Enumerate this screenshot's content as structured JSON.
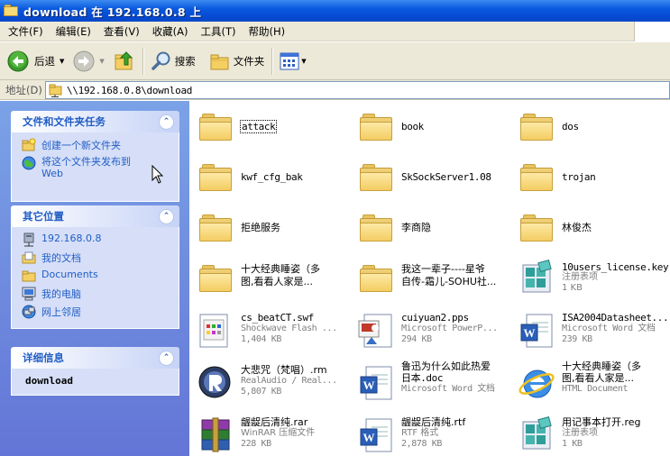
{
  "window": {
    "title": "download 在 192.168.0.8 上"
  },
  "menu": [
    {
      "label": "文件(F)"
    },
    {
      "label": "编辑(E)"
    },
    {
      "label": "查看(V)"
    },
    {
      "label": "收藏(A)"
    },
    {
      "label": "工具(T)"
    },
    {
      "label": "帮助(H)"
    }
  ],
  "toolbar": {
    "back_label": "后退",
    "search_label": "搜索",
    "folders_label": "文件夹"
  },
  "address": {
    "label": "地址(D)",
    "value": "\\\\192.168.0.8\\download"
  },
  "tasks_panel": {
    "title": "文件和文件夹任务",
    "items": [
      {
        "label": "创建一个新文件夹"
      },
      {
        "label": "将这个文件夹发布到",
        "label2": "Web"
      }
    ]
  },
  "places_panel": {
    "title": "其它位置",
    "items": [
      {
        "label": "192.168.0.8"
      },
      {
        "label": "我的文档"
      },
      {
        "label": "Documents"
      },
      {
        "label": "我的电脑"
      },
      {
        "label": "网上邻居"
      }
    ]
  },
  "details_panel": {
    "title": "详细信息",
    "name": "download"
  },
  "files": [
    {
      "name": "attack",
      "kind": "folder"
    },
    {
      "name": "book",
      "kind": "folder"
    },
    {
      "name": "dos",
      "kind": "folder"
    },
    {
      "name": "kwf_cfg_bak",
      "kind": "folder"
    },
    {
      "name": "SkSockServer1.08",
      "kind": "folder"
    },
    {
      "name": "trojan",
      "kind": "folder"
    },
    {
      "name": "拒绝服务",
      "kind": "folder"
    },
    {
      "name": "李商隐",
      "kind": "folder"
    },
    {
      "name": "林俊杰",
      "kind": "folder"
    },
    {
      "name": "十大经典睡姿（多",
      "name2": "图,看看人家是...",
      "kind": "folder"
    },
    {
      "name": "我这一辈子----星爷",
      "name2": "自传-霜儿-SOHU社...",
      "kind": "folder"
    },
    {
      "name": "10users_license.key",
      "type": "注册表项",
      "size": "1 KB",
      "kind": "reg"
    },
    {
      "name": "cs_beatCT.swf",
      "type": "Shockwave Flash ...",
      "size": "1,404 KB",
      "kind": "swf"
    },
    {
      "name": "cuiyuan2.pps",
      "type": "Microsoft PowerP...",
      "size": "294 KB",
      "kind": "pps"
    },
    {
      "name": "ISA2004Datasheet...",
      "type": "Microsoft Word 文档",
      "size": "239 KB",
      "kind": "word"
    },
    {
      "name": "大悲咒（梵唱）.rm",
      "type": "RealAudio / Real...",
      "size": "5,807 KB",
      "kind": "rm"
    },
    {
      "name": "鲁迅为什么如此热爱",
      "name2": "日本.doc",
      "type": "Microsoft Word 文档",
      "kind": "word"
    },
    {
      "name": "十大经典睡姿（多",
      "name2": "图,看看人家是...",
      "type": "HTML Document",
      "kind": "html"
    },
    {
      "name": "龌龊后清纯.rar",
      "type": "WinRAR 压缩文件",
      "size": "228 KB",
      "kind": "rar"
    },
    {
      "name": "龌龊后清纯.rtf",
      "type": "RTF 格式",
      "size": "2,878 KB",
      "kind": "word"
    },
    {
      "name": "用记事本打开.reg",
      "type": "注册表项",
      "size": "1 KB",
      "kind": "reg"
    }
  ],
  "colors": {
    "title_bar": "#0a5ae0",
    "task_pane": "#6f8ee0",
    "link": "#215dc6",
    "chrome": "#ece9d8"
  }
}
